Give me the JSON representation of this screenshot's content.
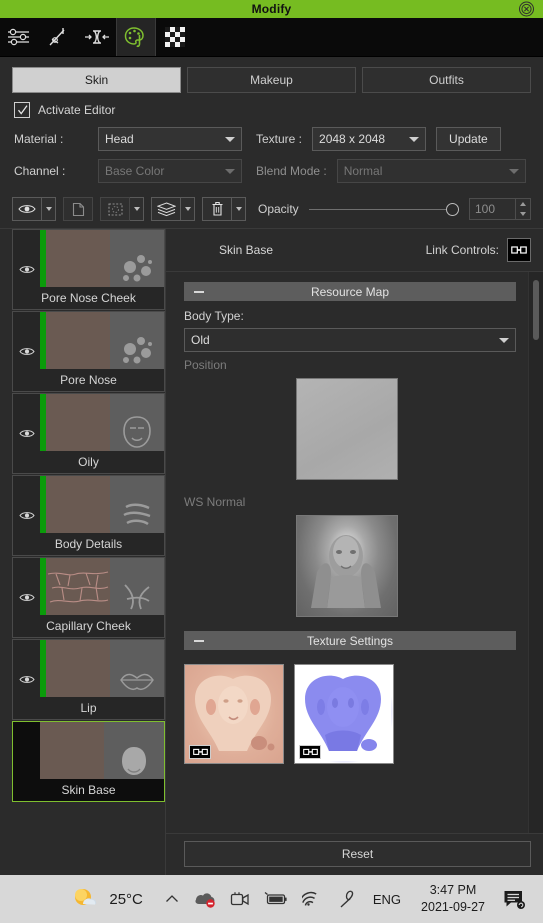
{
  "window": {
    "title": "Modify",
    "close_label": "⊗"
  },
  "toolbar": {
    "items": [
      {
        "name": "adjust-sliders-icon",
        "label": "Adjust"
      },
      {
        "name": "sculpt-icon",
        "label": "Sculpt"
      },
      {
        "name": "mesh-constrain-icon",
        "label": "Mesh"
      },
      {
        "name": "palette-icon",
        "label": "Appearance Editor",
        "active": true
      },
      {
        "name": "checkerboard-icon",
        "label": "Checker"
      }
    ],
    "accent_active": "#7fbf2f"
  },
  "tabs": [
    {
      "label": "Skin",
      "active": true
    },
    {
      "label": "Makeup",
      "active": false
    },
    {
      "label": "Outfits",
      "active": false
    }
  ],
  "activate_editor": {
    "label": "Activate Editor",
    "checked": true
  },
  "form": {
    "material_label": "Material :",
    "material_value": "Head",
    "texture_label": "Texture :",
    "texture_value": "2048 x 2048",
    "update_label": "Update",
    "channel_label": "Channel :",
    "channel_value": "Base Color",
    "blend_label": "Blend Mode :",
    "blend_value": "Normal"
  },
  "layer_toolbar": {
    "visibility_icon": "eye-icon",
    "duplicate_icon": "copy-icon",
    "select-icon": "marquee-select-icon",
    "merge_icon": "merge-layers-icon",
    "delete_icon": "trash-icon",
    "opacity_label": "Opacity",
    "opacity_value": "100"
  },
  "layers": [
    {
      "name": "Pore Nose Cheek",
      "visible": true,
      "selected": false,
      "mask_icon": "pores-icon",
      "thumb": "tx-pore"
    },
    {
      "name": "Pore Nose",
      "visible": true,
      "selected": false,
      "mask_icon": "pores-icon",
      "thumb": "tx-pore"
    },
    {
      "name": "Oily",
      "visible": true,
      "selected": false,
      "mask_icon": "head-icon",
      "thumb": "tx-oily"
    },
    {
      "name": "Body Details",
      "visible": true,
      "selected": false,
      "mask_icon": "lines-icon",
      "thumb": "tx-body"
    },
    {
      "name": "Capillary Cheek",
      "visible": true,
      "selected": false,
      "mask_icon": "capillary-icon",
      "thumb": "tx-cap"
    },
    {
      "name": "Lip",
      "visible": true,
      "selected": false,
      "mask_icon": "lips-icon",
      "thumb": "tx-lip"
    },
    {
      "name": "Skin Base",
      "visible": false,
      "selected": true,
      "mask_icon": "head-icon",
      "thumb": "tx-skinbase"
    }
  ],
  "right_panel": {
    "title": "Skin Base",
    "link_controls_label": "Link Controls:",
    "link_icon": "link-icon",
    "resource_map_section": "Resource Map",
    "body_type_label": "Body Type:",
    "body_type_value": "Old",
    "position_label": "Position",
    "ws_normal_label": "WS Normal",
    "texture_settings_section": "Texture Settings",
    "texture_thumbs": [
      {
        "name": "diffuse-texture-thumbnail",
        "badge_icon": "link-icon"
      },
      {
        "name": "normal-texture-thumbnail",
        "badge_icon": "link-icon"
      }
    ],
    "reset_label": "Reset"
  },
  "taskbar": {
    "temperature": "25°C",
    "weather_icon": "sun-cloud-icon",
    "chevron_icon": "chevron-up-icon",
    "cloud_icon": "cloud-error-icon",
    "camera_icon": "camera-icon",
    "battery_icon": "battery-icon",
    "wifi_icon": "wifi-icon",
    "pen_icon": "pen-icon",
    "language": "ENG",
    "time": "3:47 PM",
    "date": "2021-09-27",
    "notifications_icon": "notifications-icon"
  }
}
